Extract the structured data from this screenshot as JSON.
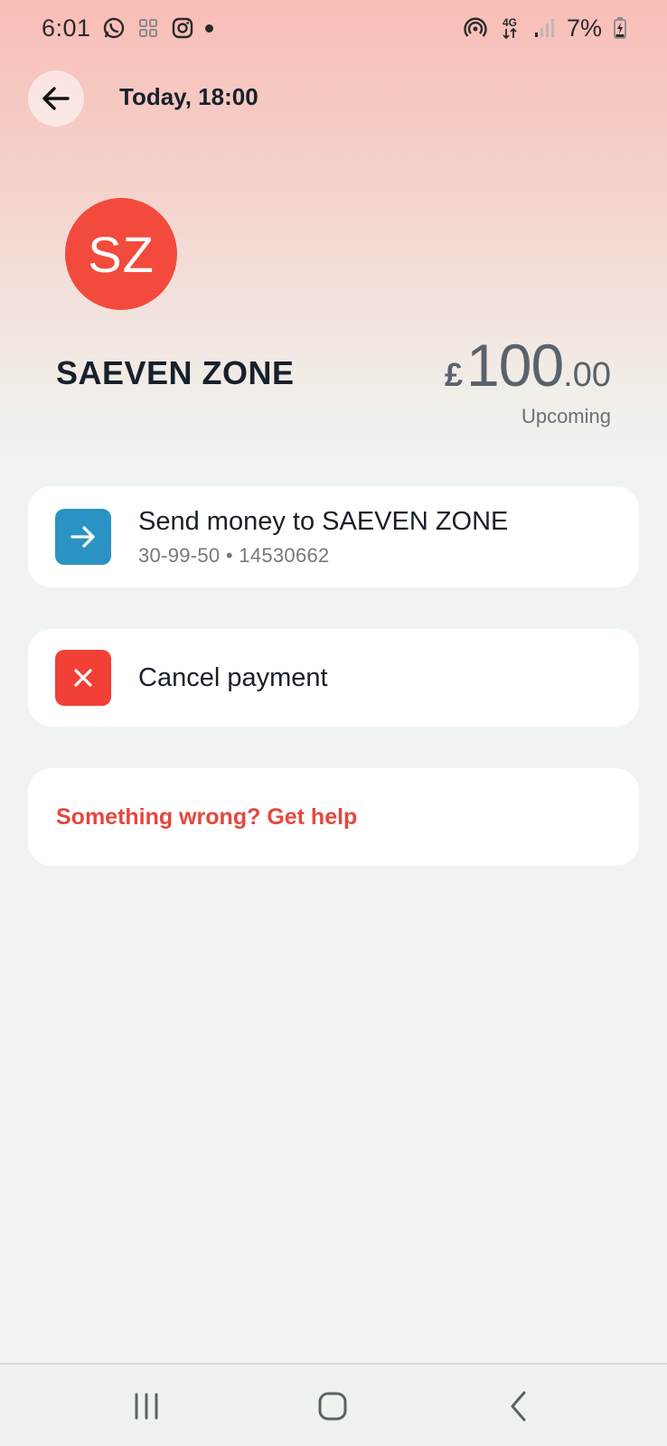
{
  "status_bar": {
    "time": "6:01",
    "network_top": "4G",
    "battery": "7%",
    "icons": [
      "whatsapp-icon",
      "scan-icon",
      "instagram-icon",
      "notification-dot",
      "hotspot-icon",
      "network-4g-icon",
      "signal-icon",
      "battery-charging-icon"
    ]
  },
  "header": {
    "title": "Today, 18:00",
    "back_icon": "arrow-left-icon"
  },
  "payee": {
    "initials": "SZ",
    "name": "SAEVEN ZONE",
    "avatar_color": "#f24b3d"
  },
  "amount": {
    "currency": "£",
    "whole": "100",
    "fraction": ".00",
    "status": "Upcoming"
  },
  "actions": {
    "send": {
      "title": "Send money to SAEVEN ZONE",
      "subtitle": "30-99-50 • 14530662",
      "icon": "arrow-right-icon",
      "color": "#2b93c4"
    },
    "cancel": {
      "title": "Cancel payment",
      "icon": "close-icon",
      "color": "#f24036"
    },
    "help": {
      "label": "Something wrong? Get help",
      "color": "#e5473c"
    }
  },
  "nav_bar": {
    "buttons": [
      "recent-apps-icon",
      "home-icon",
      "back-icon"
    ]
  }
}
